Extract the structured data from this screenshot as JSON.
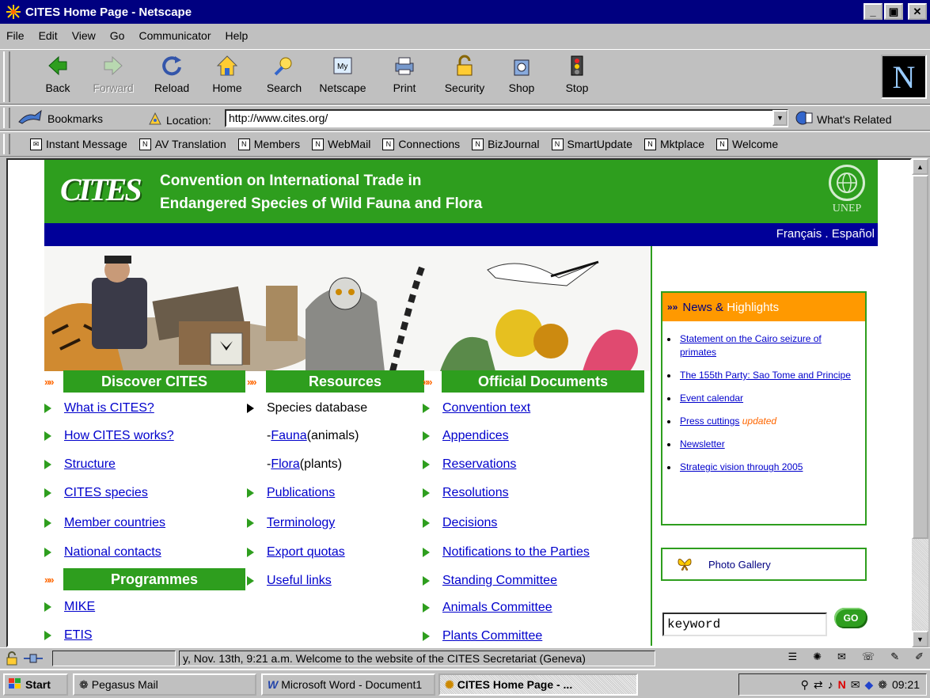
{
  "window": {
    "title": "CITES Home Page - Netscape"
  },
  "menubar": [
    "File",
    "Edit",
    "View",
    "Go",
    "Communicator",
    "Help"
  ],
  "toolbar": {
    "back": "Back",
    "forward": "Forward",
    "reload": "Reload",
    "home": "Home",
    "search": "Search",
    "netscape": "Netscape",
    "print": "Print",
    "security": "Security",
    "shop": "Shop",
    "stop": "Stop",
    "logo": "N"
  },
  "location": {
    "bookmarks": "Bookmarks",
    "label": "Location:",
    "url": "http://www.cites.org/",
    "related": "What's Related"
  },
  "personal": [
    "Instant Message",
    "AV Translation",
    "Members",
    "WebMail",
    "Connections",
    "BizJournal",
    "SmartUpdate",
    "Mktplace",
    "Welcome"
  ],
  "page": {
    "header_line1": "Convention on International Trade in",
    "header_line2": "Endangered Species of Wild Fauna and Flora",
    "logo": "CITES",
    "unep": "UNEP",
    "lang_fr": "Français",
    "lang_sep": " . ",
    "lang_es": "Español",
    "arrows": "»»",
    "discover": {
      "title": "Discover CITES",
      "items": [
        "What is CITES?",
        "How CITES works?",
        "Structure",
        "CITES species",
        "Member countries",
        "National contacts"
      ]
    },
    "programmes": {
      "title": "Programmes",
      "items": [
        "MIKE",
        "ETIS"
      ]
    },
    "resources": {
      "title": "Resources",
      "species_db": "Species database",
      "fauna_prefix": "- ",
      "fauna": "Fauna",
      "fauna_suffix": " (animals)",
      "flora_prefix": "- ",
      "flora": "Flora",
      "flora_suffix": " (plants)",
      "items": [
        "Publications",
        "Terminology",
        "Export quotas",
        "Useful links"
      ]
    },
    "official": {
      "title": "Official Documents",
      "items": [
        "Convention text",
        "Appendices",
        "Reservations",
        "Resolutions",
        "Decisions",
        "Notifications to the Parties",
        "Standing Committee",
        "Animals Committee",
        "Plants Committee"
      ]
    },
    "news": {
      "title_a": "News & ",
      "title_b": "Highlights",
      "items": [
        "Statement on the Cairo seizure of primates",
        "The 155th Party: Sao Tome and Principe",
        "Event calendar",
        "Press cuttings",
        "Newsletter",
        "Strategic vision through 2005"
      ],
      "updated": "updated"
    },
    "gallery": "Photo Gallery",
    "search_value": "keyword",
    "go": "GO"
  },
  "status": {
    "message": "y, Nov. 13th, 9:21 a.m.   Welcome to the website of the CITES Secretariat (Geneva)"
  },
  "taskbar": {
    "start": "Start",
    "tasks": [
      "Pegasus Mail",
      "Microsoft Word - Document1",
      "CITES Home Page - ..."
    ],
    "clock": "09:21"
  },
  "colors": {
    "cites_green": "#2e9e1e",
    "cites_blue": "#000099",
    "news_orange": "#ff9900",
    "titlebar": "#000080"
  }
}
